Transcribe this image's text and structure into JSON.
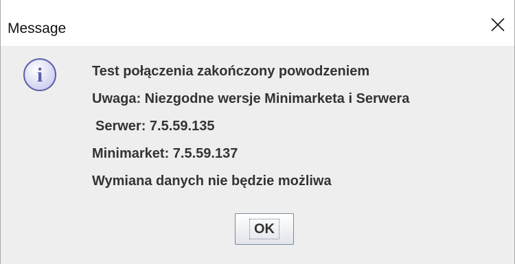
{
  "dialog": {
    "title": "Message",
    "close_icon": "close-icon",
    "icon": "info-icon",
    "icon_glyph": "i",
    "messages": [
      "Test połączenia zakończony powodzeniem",
      "Uwaga: Niezgodne wersje Minimarketa i Serwera",
      "Serwer: 7.5.59.135",
      "Minimarket: 7.5.59.137",
      "Wymiana danych nie będzie możliwa"
    ],
    "ok_label": "OK"
  },
  "colors": {
    "titlebar_bg": "#ffffff",
    "client_bg": "#eeeeee",
    "text": "#333333",
    "icon_border": "#5b5fa8",
    "icon_fill": "#d9dbf2"
  }
}
